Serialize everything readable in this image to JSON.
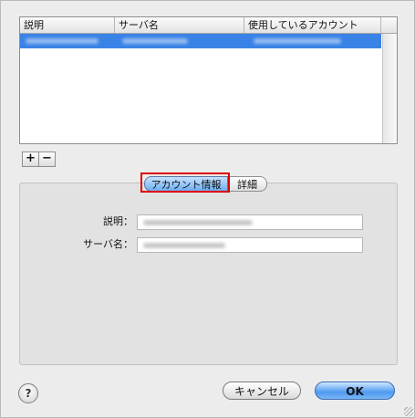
{
  "table": {
    "columns": [
      "説明",
      "サーバ名",
      "使用しているアカウント"
    ],
    "rows": [
      {
        "selected": true,
        "description": "",
        "server": "",
        "account": ""
      }
    ]
  },
  "toolbar": {
    "add_label": "+",
    "remove_label": "−"
  },
  "tabs": [
    {
      "label": "アカウント情報",
      "active": true
    },
    {
      "label": "詳細",
      "active": false
    }
  ],
  "form": {
    "description_label": "説明：",
    "server_label": "サーバ名：",
    "description_value": "",
    "server_value": ""
  },
  "buttons": {
    "help_label": "?",
    "cancel_label": "キャンセル",
    "ok_label": "OK"
  },
  "colors": {
    "selection": "#3a83e6",
    "highlight_box": "#e00000",
    "default_button": "#4e9af0"
  }
}
